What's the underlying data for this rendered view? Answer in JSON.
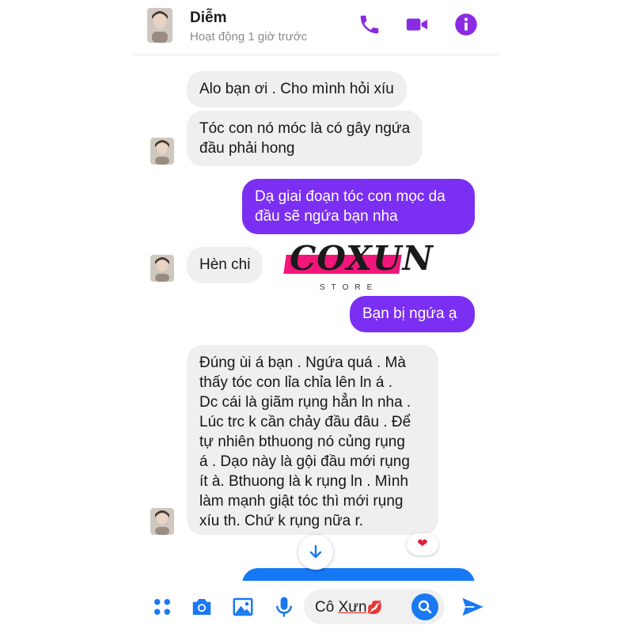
{
  "header": {
    "contact_name": "Diễm",
    "status": "Hoạt động 1 giờ trước",
    "icons": [
      "phone-icon",
      "video-call-icon",
      "info-icon"
    ]
  },
  "messages": [
    {
      "side": "in",
      "text": "Alo bạn ơi . Cho mình hỏi xíu"
    },
    {
      "side": "in",
      "lines": [
        "Tóc con nó móc là có gây ngứa",
        "đầu phải hong"
      ]
    },
    {
      "side": "out",
      "lines": [
        "Dạ giai đoạn tóc con mọc da",
        "đầu sẽ ngứa bạn nha"
      ]
    },
    {
      "side": "in",
      "text": "Hèn chi"
    },
    {
      "side": "out",
      "text": "Bạn bị ngứa ạ"
    },
    {
      "side": "in",
      "lines": [
        "Đúng ùi á bạn . Ngứa quá . Mà",
        "thấy tóc con lỉa chỉa lên ln  á .",
        "Dc cái là giãm rụng hẳn ln nha .",
        "Lúc trc k cần chảy đầu đâu . Để",
        "tự nhiên bthuong nó củng rụng",
        "á . Dạo này là gội đầu mới rụng",
        "ít à. Bthuong là k rụng ln . Mình",
        "làm mạnh giật tóc thì mới rụng",
        "xíu th. Chứ k rụng nữa r."
      ],
      "reaction": "❤"
    }
  ],
  "watermark": {
    "brand": "COXUN",
    "sub": "STORE"
  },
  "composer": {
    "text_prefix": "Cô ",
    "text_underlined": "Xưn",
    "emoji": "💋"
  },
  "colors": {
    "accent": "#7a2ff2",
    "messenger_blue": "#1578f5",
    "incoming_bg": "#efefef"
  }
}
